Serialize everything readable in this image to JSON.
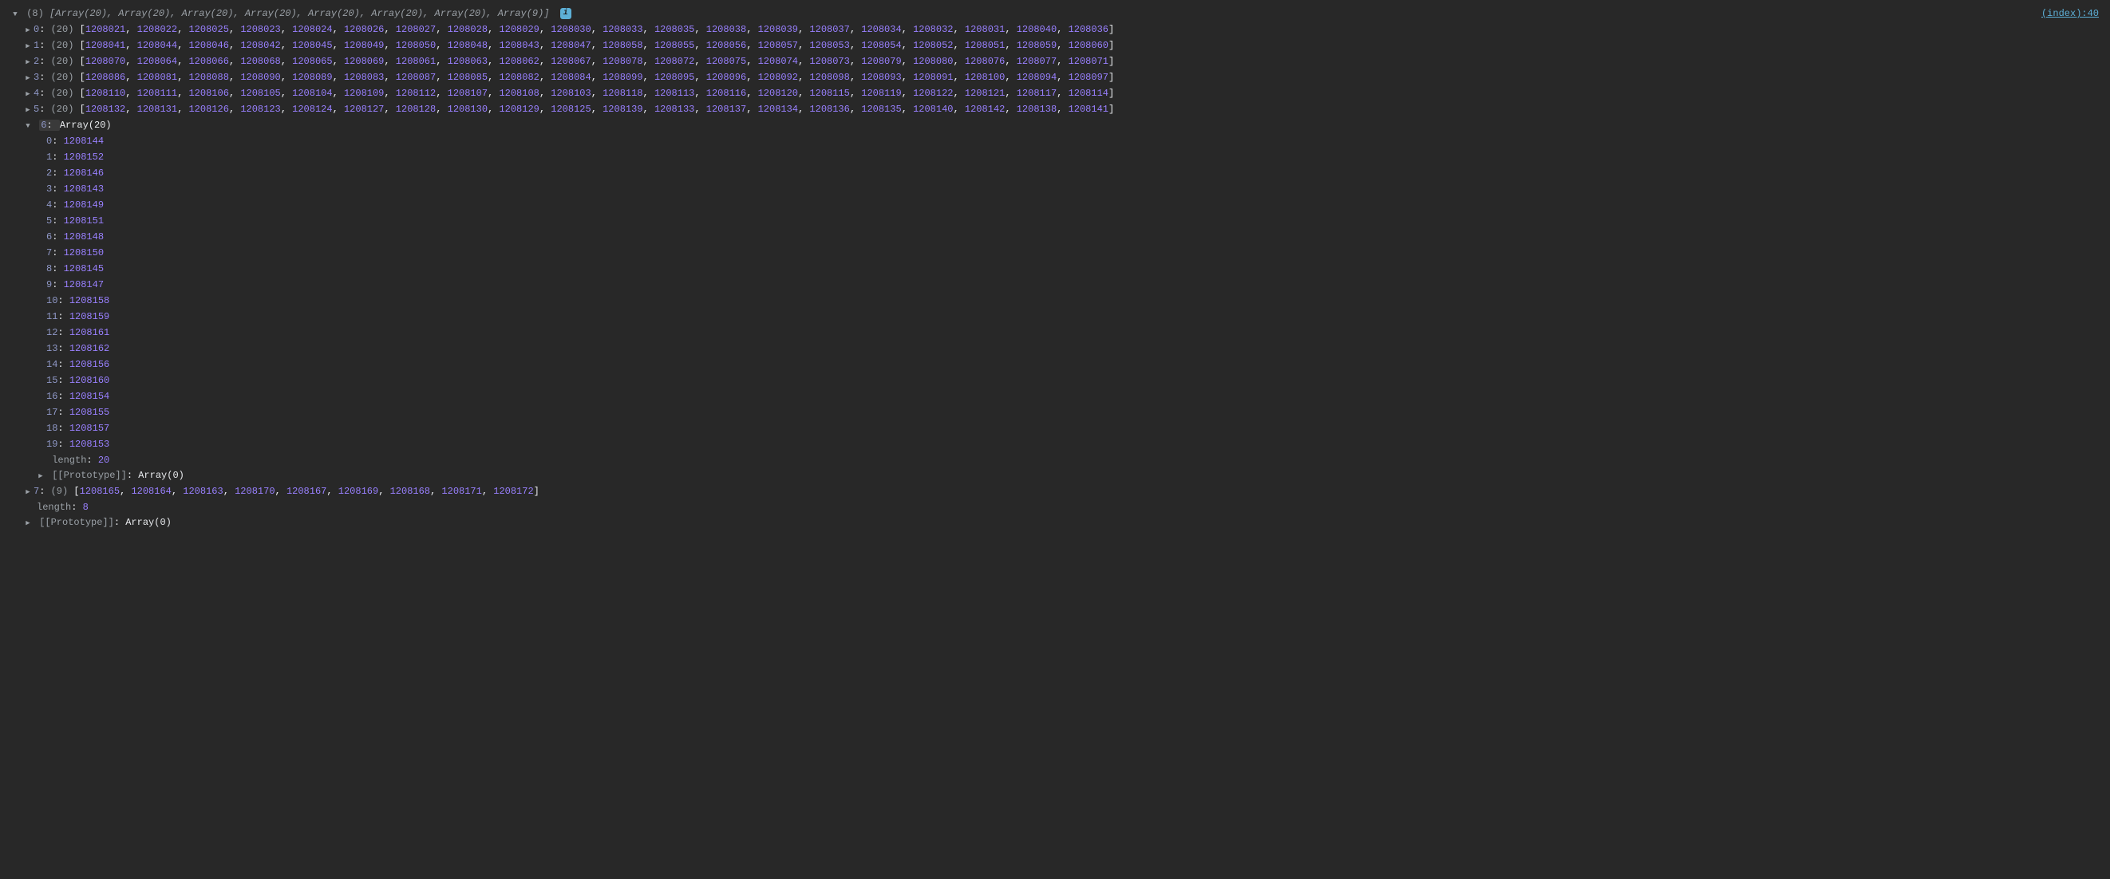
{
  "sourceLink": "(index):40",
  "summaryCount": "(8)",
  "summaryParts": [
    "Array(20)",
    "Array(20)",
    "Array(20)",
    "Array(20)",
    "Array(20)",
    "Array(20)",
    "Array(20)",
    "Array(9)"
  ],
  "rows": [
    {
      "idx": "0",
      "len": "(20)",
      "vals": [
        1208021,
        1208022,
        1208025,
        1208023,
        1208024,
        1208026,
        1208027,
        1208028,
        1208029,
        1208030,
        1208033,
        1208035,
        1208038,
        1208039,
        1208037,
        1208034,
        1208032,
        1208031,
        1208040,
        1208036
      ]
    },
    {
      "idx": "1",
      "len": "(20)",
      "vals": [
        1208041,
        1208044,
        1208046,
        1208042,
        1208045,
        1208049,
        1208050,
        1208048,
        1208043,
        1208047,
        1208058,
        1208055,
        1208056,
        1208057,
        1208053,
        1208054,
        1208052,
        1208051,
        1208059,
        1208060
      ]
    },
    {
      "idx": "2",
      "len": "(20)",
      "vals": [
        1208070,
        1208064,
        1208066,
        1208068,
        1208065,
        1208069,
        1208061,
        1208063,
        1208062,
        1208067,
        1208078,
        1208072,
        1208075,
        1208074,
        1208073,
        1208079,
        1208080,
        1208076,
        1208077,
        1208071
      ]
    },
    {
      "idx": "3",
      "len": "(20)",
      "vals": [
        1208086,
        1208081,
        1208088,
        1208090,
        1208089,
        1208083,
        1208087,
        1208085,
        1208082,
        1208084,
        1208099,
        1208095,
        1208096,
        1208092,
        1208098,
        1208093,
        1208091,
        1208100,
        1208094,
        1208097
      ]
    },
    {
      "idx": "4",
      "len": "(20)",
      "vals": [
        1208110,
        1208111,
        1208106,
        1208105,
        1208104,
        1208109,
        1208112,
        1208107,
        1208108,
        1208103,
        1208118,
        1208113,
        1208116,
        1208120,
        1208115,
        1208119,
        1208122,
        1208121,
        1208117,
        1208114
      ]
    },
    {
      "idx": "5",
      "len": "(20)",
      "vals": [
        1208132,
        1208131,
        1208126,
        1208123,
        1208124,
        1208127,
        1208128,
        1208130,
        1208129,
        1208125,
        1208139,
        1208133,
        1208137,
        1208134,
        1208136,
        1208135,
        1208140,
        1208142,
        1208138,
        1208141
      ]
    }
  ],
  "expandedIdx": "6",
  "expandedType": "Array(20)",
  "expandedItems": [
    {
      "k": "0",
      "v": 1208144
    },
    {
      "k": "1",
      "v": 1208152
    },
    {
      "k": "2",
      "v": 1208146
    },
    {
      "k": "3",
      "v": 1208143
    },
    {
      "k": "4",
      "v": 1208149
    },
    {
      "k": "5",
      "v": 1208151
    },
    {
      "k": "6",
      "v": 1208148
    },
    {
      "k": "7",
      "v": 1208150
    },
    {
      "k": "8",
      "v": 1208145
    },
    {
      "k": "9",
      "v": 1208147
    },
    {
      "k": "10",
      "v": 1208158
    },
    {
      "k": "11",
      "v": 1208159
    },
    {
      "k": "12",
      "v": 1208161
    },
    {
      "k": "13",
      "v": 1208162
    },
    {
      "k": "14",
      "v": 1208156
    },
    {
      "k": "15",
      "v": 1208160
    },
    {
      "k": "16",
      "v": 1208154
    },
    {
      "k": "17",
      "v": 1208155
    },
    {
      "k": "18",
      "v": 1208157
    },
    {
      "k": "19",
      "v": 1208153
    }
  ],
  "expandedLengthLabel": "length",
  "expandedLengthValue": "20",
  "protoInnerLabel": "[[Prototype]]",
  "protoInnerValue": "Array(0)",
  "row7Idx": "7",
  "row7Len": "(9)",
  "row7Vals": [
    1208165,
    1208164,
    1208163,
    1208170,
    1208167,
    1208169,
    1208168,
    1208171,
    1208172
  ],
  "outerLengthLabel": "length",
  "outerLengthValue": "8",
  "protoOuterLabel": "[[Prototype]]",
  "protoOuterValue": "Array(0)"
}
